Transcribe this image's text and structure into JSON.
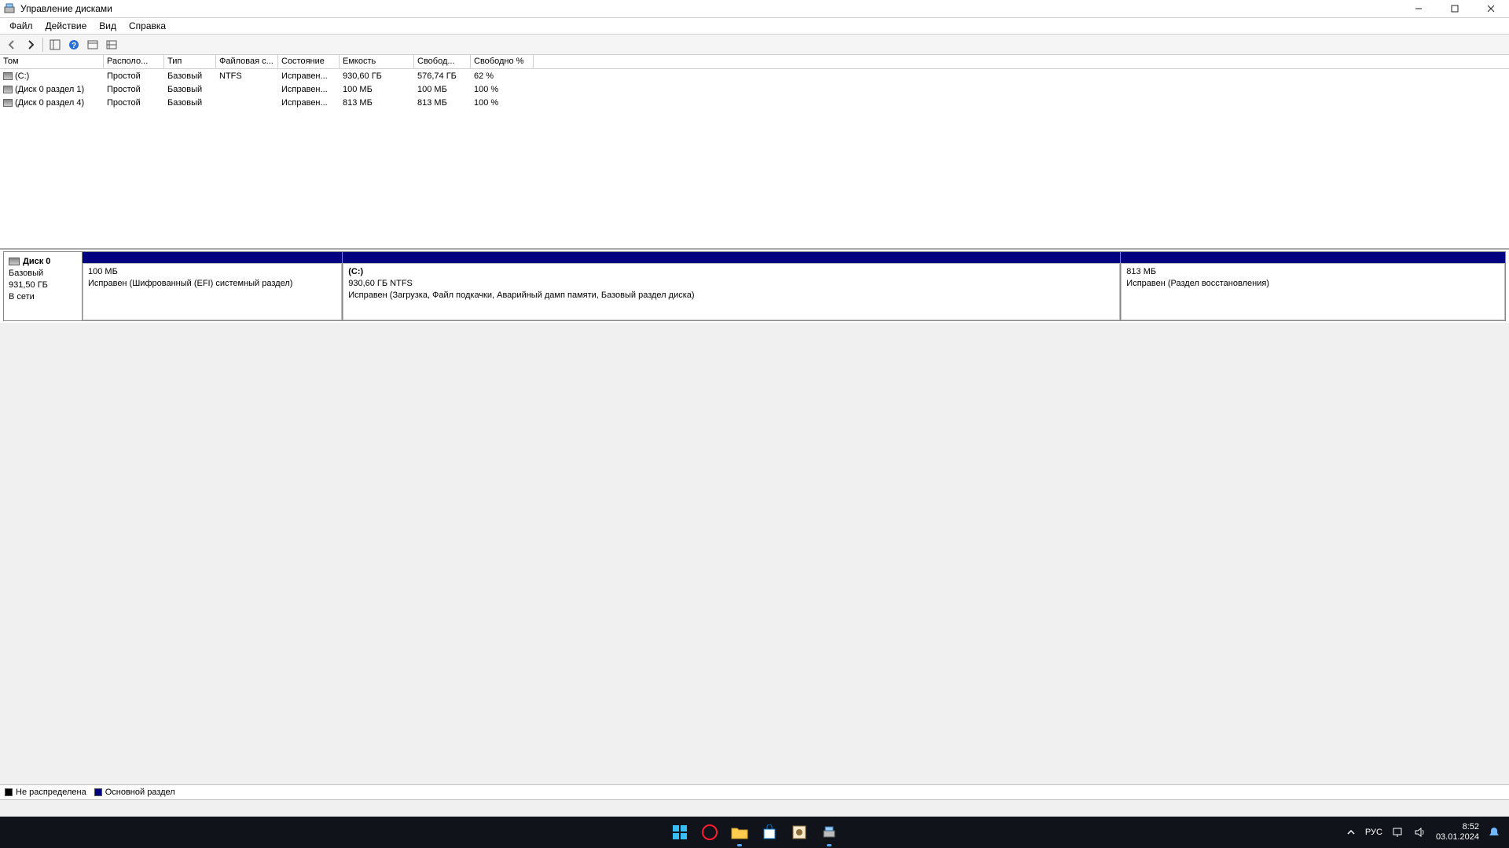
{
  "window": {
    "title": "Управление дисками"
  },
  "menu": {
    "file": "Файл",
    "action": "Действие",
    "view": "Вид",
    "help": "Справка"
  },
  "columns": {
    "volume": "Том",
    "layout": "Располо...",
    "type": "Тип",
    "fs": "Файловая с...",
    "status": "Состояние",
    "capacity": "Емкость",
    "free": "Свобод...",
    "freepct": "Свободно %"
  },
  "volumes": [
    {
      "name": "(C:)",
      "layout": "Простой",
      "type": "Базовый",
      "fs": "NTFS",
      "status": "Исправен...",
      "capacity": "930,60 ГБ",
      "free": "576,74 ГБ",
      "freepct": "62 %"
    },
    {
      "name": "(Диск 0 раздел 1)",
      "layout": "Простой",
      "type": "Базовый",
      "fs": "",
      "status": "Исправен...",
      "capacity": "100 МБ",
      "free": "100 МБ",
      "freepct": "100 %"
    },
    {
      "name": "(Диск 0 раздел 4)",
      "layout": "Простой",
      "type": "Базовый",
      "fs": "",
      "status": "Исправен...",
      "capacity": "813 МБ",
      "free": "813 МБ",
      "freepct": "100 %"
    }
  ],
  "disk": {
    "name": "Диск 0",
    "type": "Базовый",
    "size": "931,50 ГБ",
    "state": "В сети",
    "partitions": [
      {
        "label": "",
        "size": "100 МБ",
        "status": "Исправен (Шифрованный (EFI) системный раздел)",
        "widthpct": 18.3
      },
      {
        "label": "(C:)",
        "size": "930,60 ГБ NTFS",
        "status": "Исправен (Загрузка, Файл подкачки, Аварийный дамп памяти, Базовый раздел диска)",
        "widthpct": 54.7
      },
      {
        "label": "",
        "size": "813 МБ",
        "status": "Исправен (Раздел восстановления)",
        "widthpct": 27.0
      }
    ]
  },
  "legend": {
    "unalloc": "Не распределена",
    "primary": "Основной раздел"
  },
  "taskbar": {
    "lang": "РУС",
    "time": "8:52",
    "date": "03.01.2024"
  }
}
